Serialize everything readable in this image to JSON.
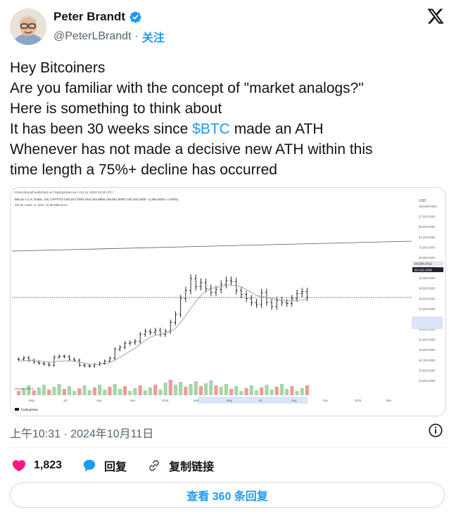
{
  "author": {
    "display_name": "Peter Brandt",
    "handle": "@PeterLBrandt",
    "separator": "·",
    "follow_label": "关注",
    "verified": true
  },
  "tweet": {
    "lines": [
      "Hey Bitcoiners",
      "Are you familiar with the concept of \"market analogs?\"",
      "Here is something to think about"
    ],
    "line4_before": "It has been 30 weeks since ",
    "line4_cashtag": "$BTC",
    "line4_after": " made an ATH",
    "line5": "Whenever has not made a decisive new ATH within this",
    "line6": "time length a 75%+ decline has occurred"
  },
  "chart_meta": {
    "header": "PeterLBrandt published on TradingView.com, Oct 11, 2024 02:00 UTC",
    "symbol_line": "Bitcoin / U.S. Dollar, 1W, CRYPTO O62,817.0000 H64,404.9900 L58,901.8000 C60,432.4000 −2,384.6000 (−3.80%)",
    "ma_line": "MA (8, close, 0, SMA, 8) 68,998.3412",
    "currency": "USD",
    "volume_label": "Volume SMA 9",
    "tradingview": "TradingView",
    "last_price_tag": "60,432.4000",
    "ma_tag": "68,998.3412"
  },
  "chart_data": {
    "type": "line",
    "title": "Bitcoin / U.S. Dollar, 1W, CRYPTO",
    "xlabel": "",
    "ylabel": "",
    "x_tick_labels": [
      "May",
      "Jul",
      "Sep",
      "Nov",
      "2024",
      "Mar",
      "May",
      "Jul",
      "Sep",
      "Nov",
      "2025",
      "Mar"
    ],
    "y_tick_labels": [
      "105,000.0000",
      "97,000.0000",
      "89,000.0000",
      "81,000.0000",
      "73,000.0000",
      "65,000.0000",
      "57,600.0000",
      "52,300.0000",
      "49,900.0000",
      "45,900.0000",
      "41,900.0000",
      "37,600.0000",
      "34,900.0000",
      "31,900.0000",
      "29,900.0000",
      "26,700.0000",
      "24,900.0000",
      "22,800.0000"
    ],
    "ylim": [
      22000,
      105000
    ],
    "series": [
      {
        "name": "Bitcoin / U.S. Dollar",
        "values": [
          29500,
          30200,
          29000,
          28000,
          27500,
          27000,
          26500,
          30500,
          31000,
          30800,
          29500,
          29000,
          26500,
          26200,
          26000,
          26800,
          27500,
          28500,
          30000,
          34500,
          35500,
          37500,
          37800,
          38500,
          42000,
          43500,
          43000,
          44000,
          42000,
          43500,
          48000,
          52000,
          60000,
          64000,
          70000,
          66000,
          68000,
          65000,
          63000,
          64500,
          67000,
          69000,
          68500,
          64000,
          62000,
          60000,
          58000,
          57000,
          63000,
          58000,
          56000,
          59000,
          58000,
          57500,
          60000,
          62500,
          63500,
          60500
        ]
      },
      {
        "name": "MA (8, close, 0, SMA, 8)",
        "values": [
          28500,
          28700,
          28900,
          28800,
          28600,
          28300,
          28000,
          28200,
          28500,
          28600,
          28700,
          28500,
          28000,
          27500,
          27000,
          26800,
          26900,
          27200,
          27800,
          29000,
          30500,
          32000,
          33500,
          35000,
          37000,
          39000,
          40500,
          41500,
          42000,
          42500,
          43500,
          45000,
          48000,
          51500,
          55000,
          58500,
          61500,
          63500,
          65000,
          65500,
          66000,
          66500,
          66800,
          66500,
          65800,
          64500,
          63000,
          61500,
          61000,
          60500,
          60000,
          59500,
          59000,
          58800,
          58800,
          59000,
          59300,
          59600
        ]
      }
    ]
  },
  "timestamp": "上午10:31 · 2024年10月11日",
  "actions": {
    "likes": "1,823",
    "reply_label": "回复",
    "copy_link_label": "复制链接"
  },
  "replies_button": "查看 360 条回复",
  "colors": {
    "accent": "#1d9bf0",
    "like": "#f91880",
    "text": "#0f1419",
    "muted": "#536471"
  }
}
